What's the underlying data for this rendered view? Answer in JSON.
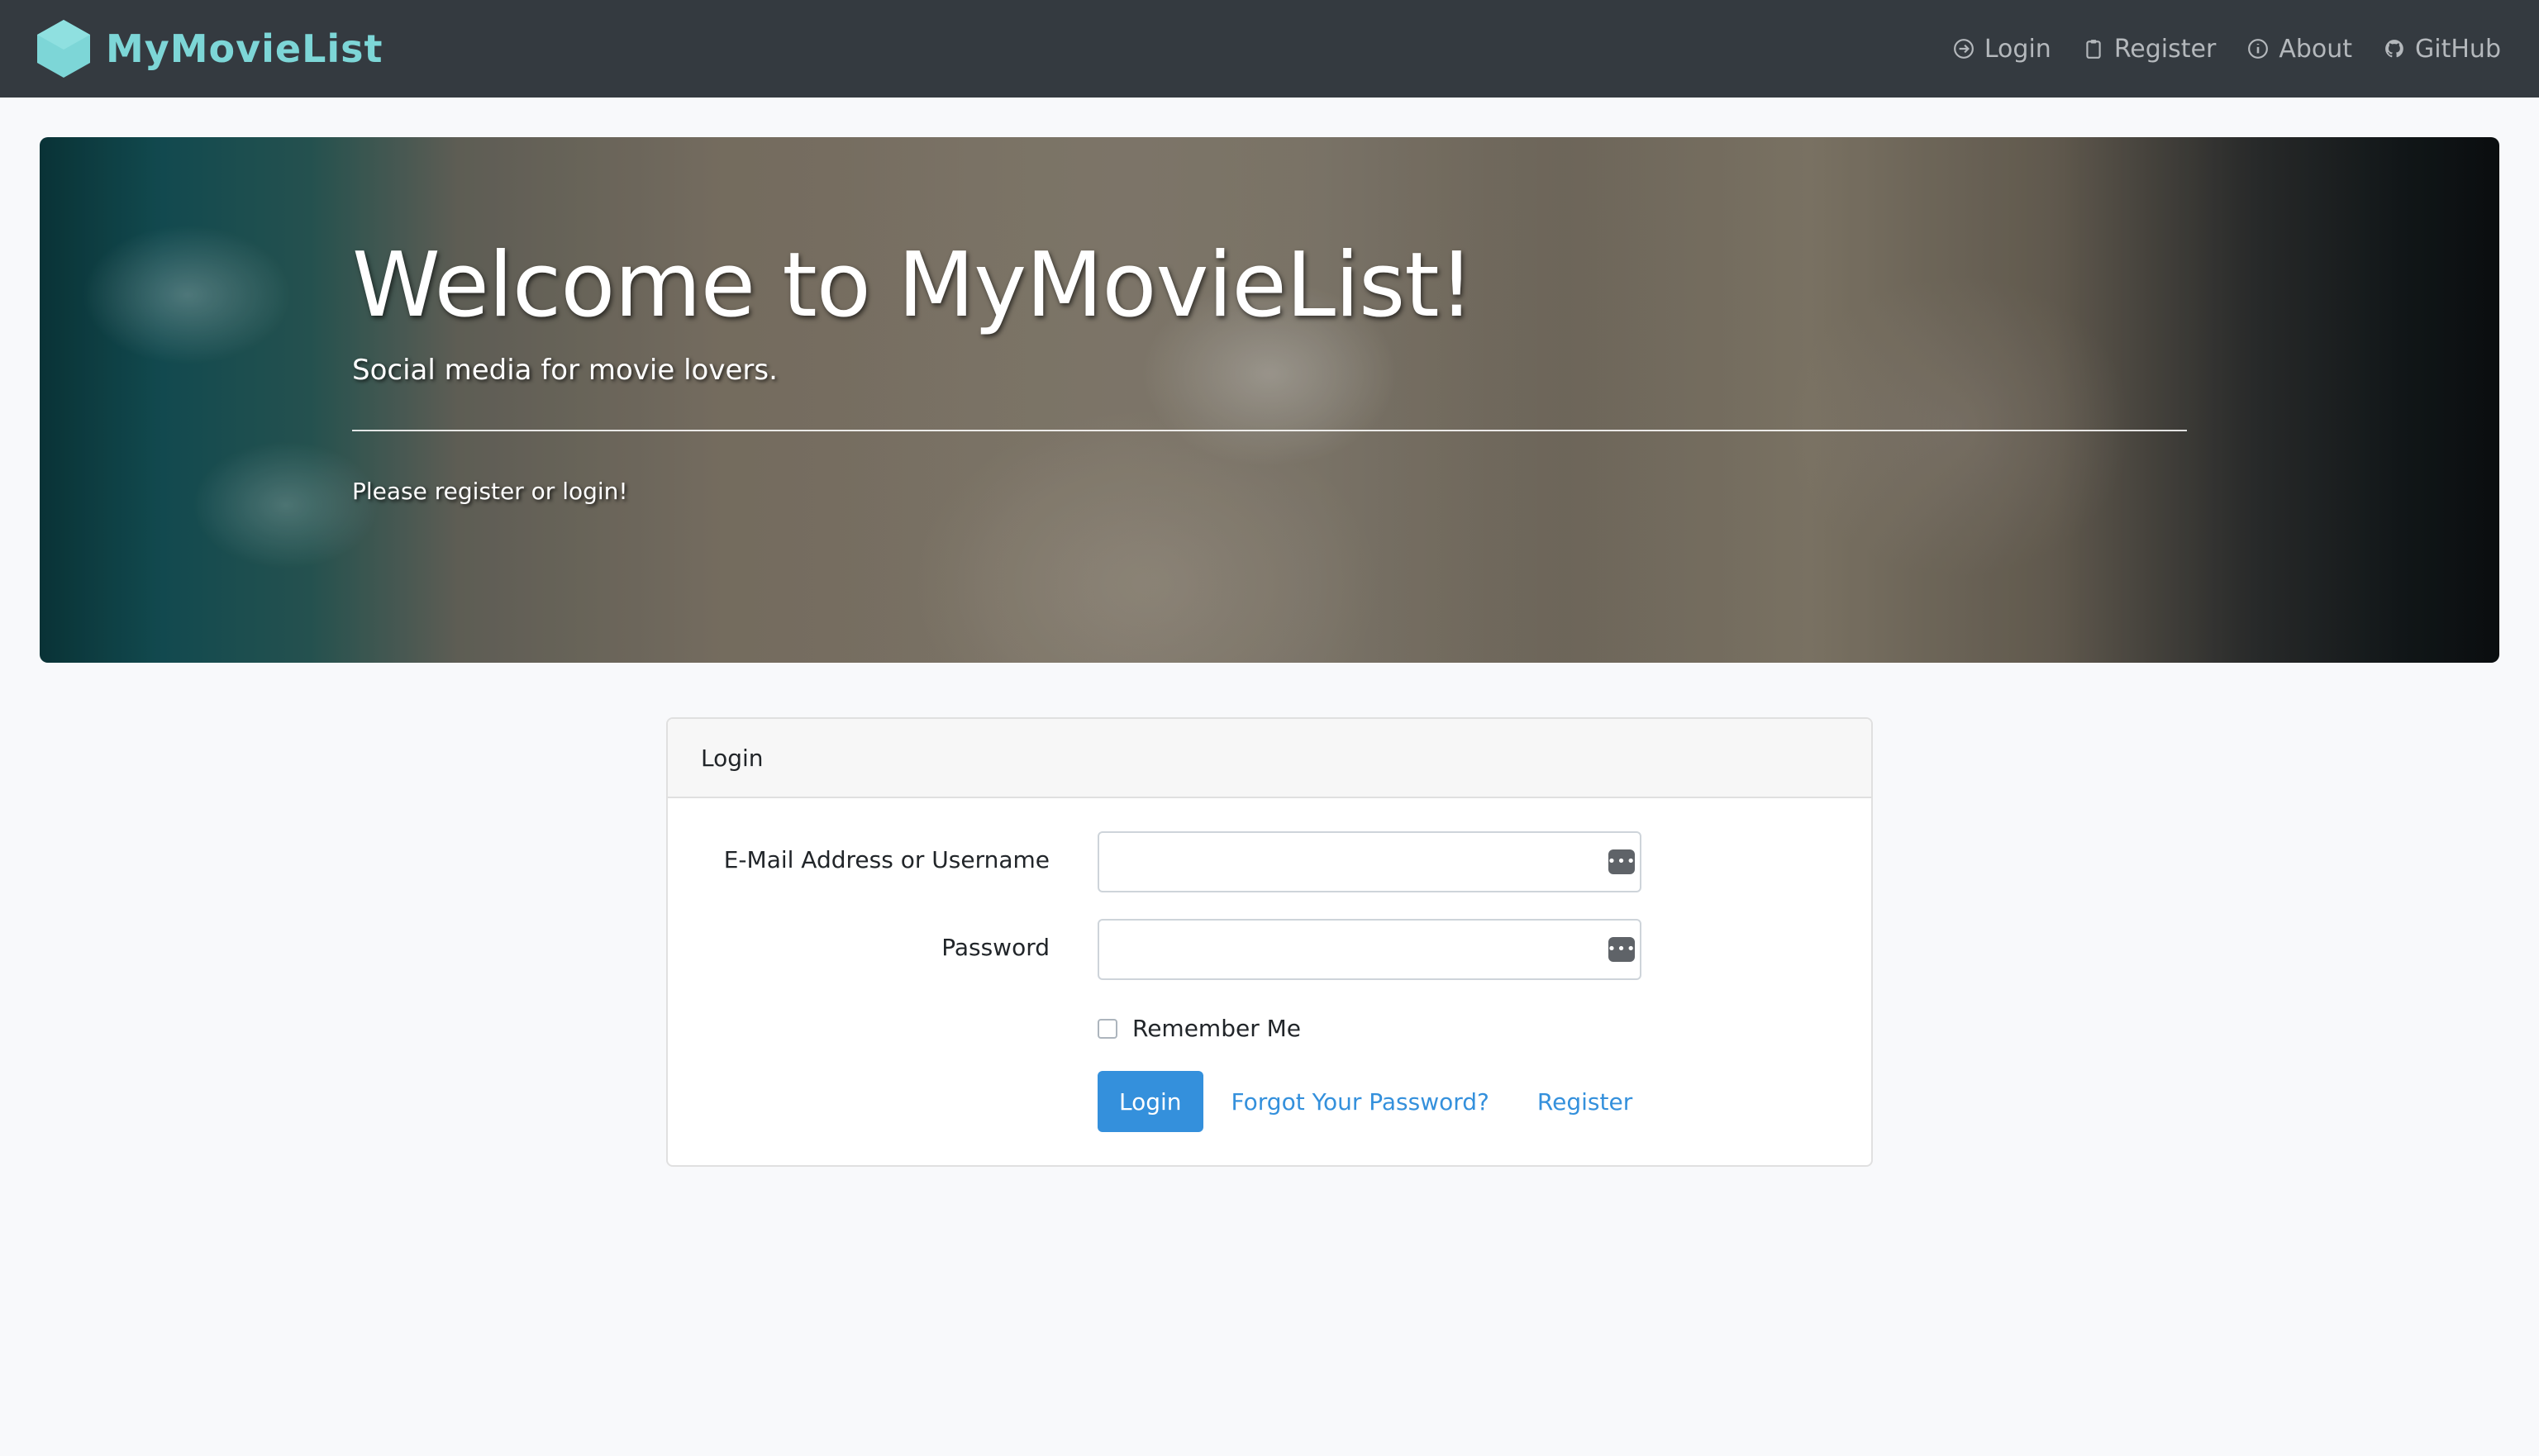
{
  "navbar": {
    "brand": "MyMovieList",
    "links": [
      {
        "label": "Login",
        "icon": "login-icon"
      },
      {
        "label": "Register",
        "icon": "clipboard-icon"
      },
      {
        "label": "About",
        "icon": "info-icon"
      },
      {
        "label": "GitHub",
        "icon": "github-icon"
      }
    ]
  },
  "hero": {
    "title": "Welcome to MyMovieList!",
    "subtitle": "Social media for movie lovers.",
    "note": "Please register or login!"
  },
  "login_card": {
    "header": "Login",
    "email_label": "E-Mail Address or Username",
    "password_label": "Password",
    "email_value": "",
    "password_value": "",
    "remember_label": "Remember Me",
    "submit_label": "Login",
    "forgot_label": "Forgot Your Password?",
    "register_label": "Register"
  },
  "colors": {
    "navbar_bg": "#343a40",
    "brand": "#7dd6d7",
    "primary": "#3490dc",
    "page_bg": "#f8f9fb"
  }
}
